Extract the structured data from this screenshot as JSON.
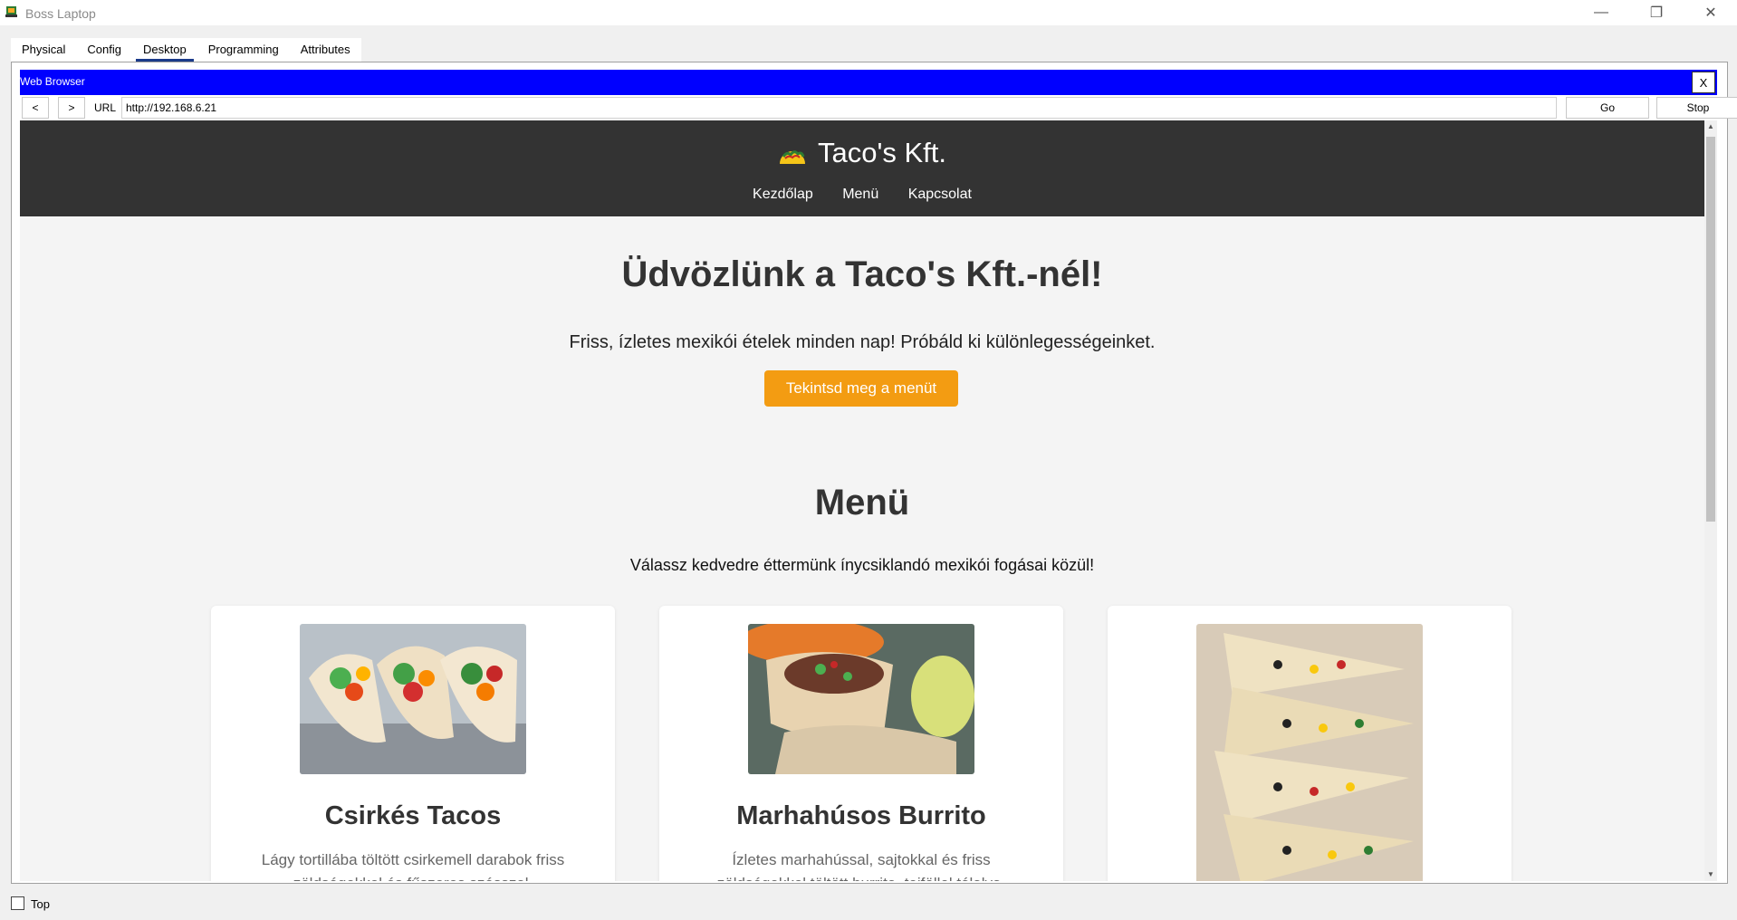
{
  "window": {
    "title": "Boss Laptop",
    "minimize": "—",
    "restore": "❐",
    "close": "✕"
  },
  "tabs": [
    {
      "label": "Physical"
    },
    {
      "label": "Config"
    },
    {
      "label": "Desktop"
    },
    {
      "label": "Programming"
    },
    {
      "label": "Attributes"
    }
  ],
  "browser": {
    "title": "Web Browser",
    "close_label": "X",
    "back": "<",
    "forward": ">",
    "url_label": "URL",
    "url": "http://192.168.6.21",
    "go": "Go",
    "stop": "Stop"
  },
  "site": {
    "brand": "Taco's Kft.",
    "nav": [
      "Kezdőlap",
      "Menü",
      "Kapcsolat"
    ],
    "hero_title": "Üdvözlünk a Taco's Kft.-nél!",
    "hero_text": "Friss, ízletes mexikói ételek minden nap! Próbáld ki különlegességeinket.",
    "cta": "Tekintsd meg a menüt",
    "menu_title": "Menü",
    "menu_subtitle": "Válassz kedvedre éttermünk ínycsiklandó mexikói fogásai közül!",
    "cards": [
      {
        "name": "Csirkés Tacos",
        "desc": "Lágy tortillába töltött csirkemell darabok friss zöldségekkel és fűszeres szósszal."
      },
      {
        "name": "Marhahúsos Burrito",
        "desc": "Ízletes marhahússal, sajtokkal és friss zöldségekkel töltött burrito, tejföllel tálalva."
      },
      {
        "name": "",
        "desc": ""
      }
    ]
  },
  "footer": {
    "top_label": "Top"
  },
  "colors": {
    "browser_bar": "#0000ff",
    "header_bg": "#333333",
    "cta": "#f39c12"
  }
}
